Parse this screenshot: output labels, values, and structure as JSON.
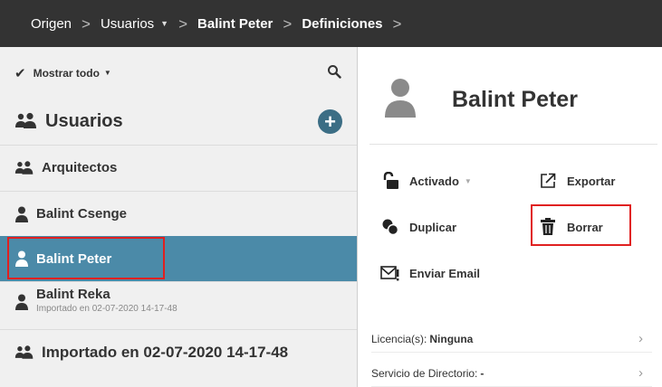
{
  "breadcrumb": {
    "items": [
      "Origen",
      "Usuarios",
      "Balint Peter",
      "Definiciones"
    ],
    "separator": ">"
  },
  "filter": {
    "label": "Mostrar todo"
  },
  "users_header": {
    "title": "Usuarios"
  },
  "list": {
    "items": [
      {
        "label": "Arquitectos",
        "icon": "group-icon"
      },
      {
        "label": "Balint Csenge",
        "icon": "user-icon"
      },
      {
        "label": "Balint Peter",
        "icon": "user-icon",
        "selected": true
      },
      {
        "label": "Balint Reka",
        "sublabel": "Importado en 02-07-2020 14-17-48",
        "icon": "user-icon"
      },
      {
        "label": "Importado en 02-07-2020 14-17-48",
        "icon": "group-icon"
      }
    ]
  },
  "profile": {
    "name": "Balint Peter"
  },
  "actions": {
    "enabled": "Activado",
    "export": "Exportar",
    "duplicate": "Duplicar",
    "delete": "Borrar",
    "email": "Enviar Email"
  },
  "info": {
    "license_label": "Licencia(s):",
    "license_value": "Ninguna",
    "directory_label": "Servicio de Directorio:",
    "directory_value": "-"
  },
  "colors": {
    "topbar": "#333333",
    "selected_row": "#4b8aa8",
    "highlight_outline": "#e02020",
    "add_button": "#3c6e85"
  }
}
